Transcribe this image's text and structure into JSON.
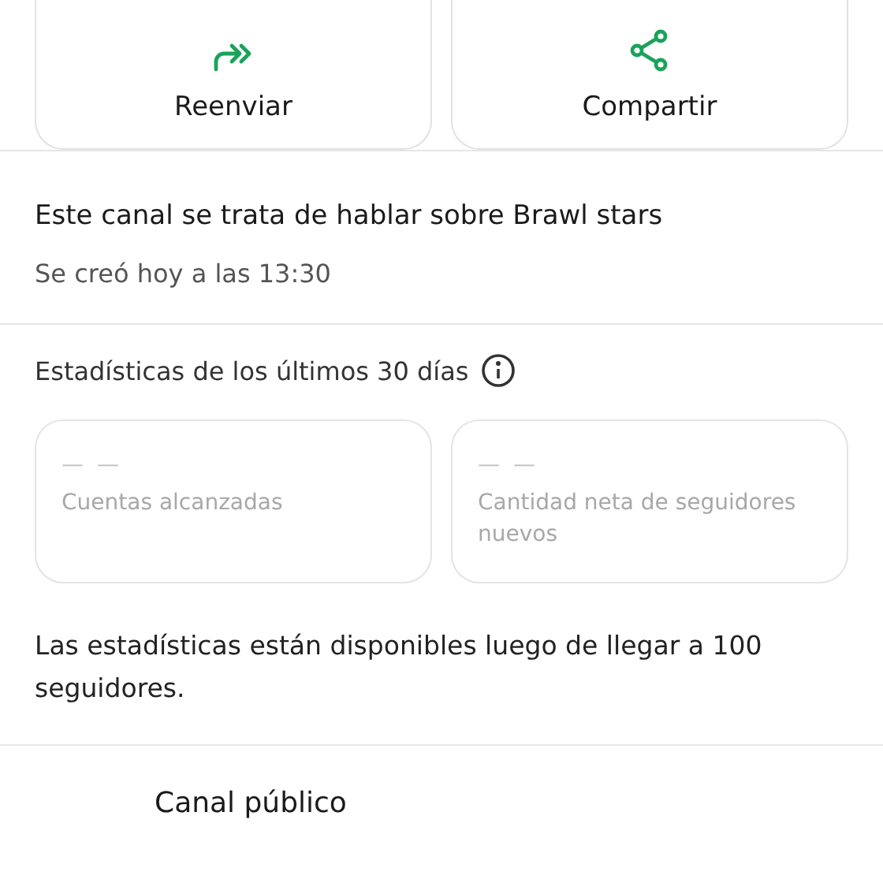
{
  "actions": [
    {
      "label": "Reenviar",
      "kind": "forward"
    },
    {
      "label": "Compartir",
      "kind": "share"
    }
  ],
  "description": "Este canal se trata de hablar sobre Brawl stars",
  "created": "Se creó hoy a las 13:30",
  "stats": {
    "title": "Estadísticas de los últimos 30 días",
    "cards": [
      {
        "value": "— —",
        "label": "Cuentas alcanzadas"
      },
      {
        "value": "— —",
        "label": "Cantidad neta de seguidores nuevos"
      }
    ],
    "note": "Las estadísticas están disponibles luego de llegar a 100 seguidores."
  },
  "privacy": {
    "label": "Canal público"
  }
}
